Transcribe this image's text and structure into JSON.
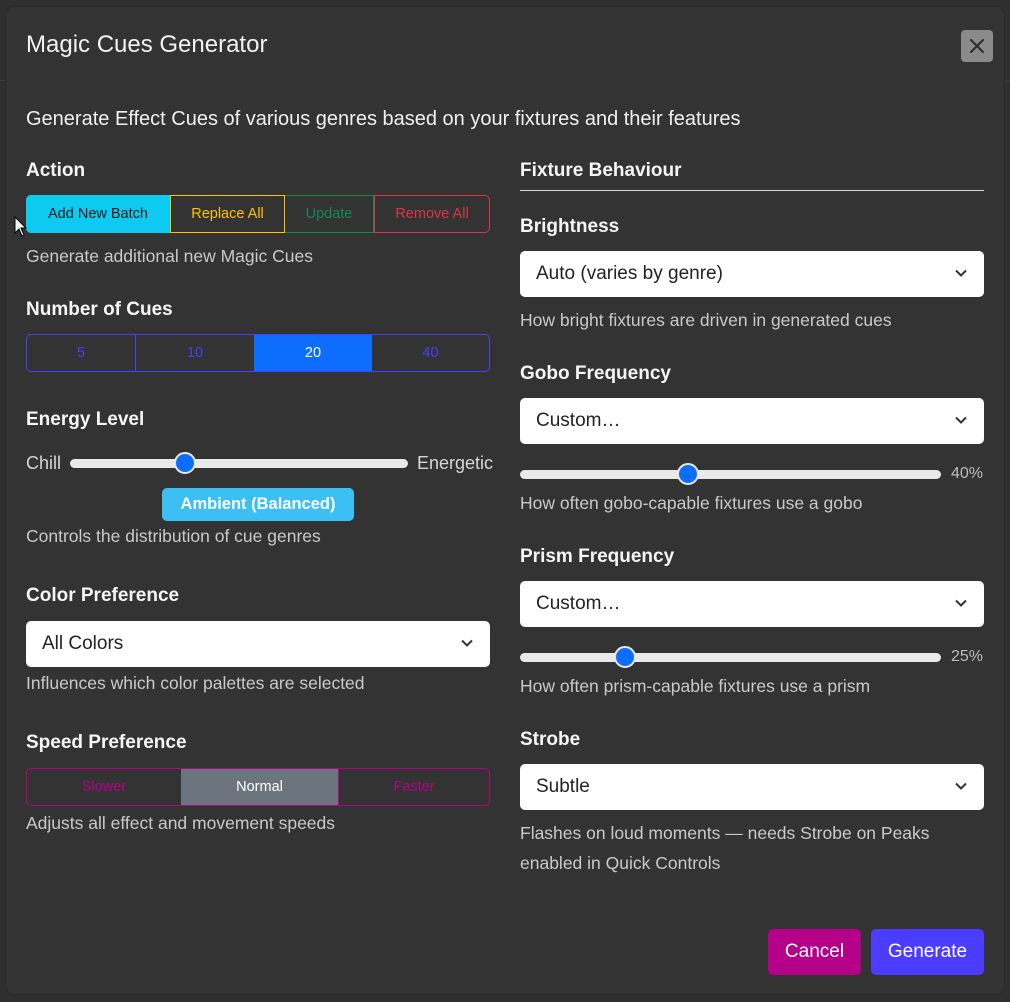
{
  "dialog": {
    "title": "Magic Cues Generator",
    "intro": "Generate Effect Cues of various genres based on your fixtures and their features"
  },
  "action": {
    "label": "Action",
    "buttons": [
      "Add New Batch",
      "Replace All",
      "Update",
      "Remove All"
    ],
    "selected": "Add New Batch",
    "help": "Generate additional new Magic Cues"
  },
  "num_cues": {
    "label": "Number of Cues",
    "options": [
      "5",
      "10",
      "20",
      "40"
    ],
    "selected": "20"
  },
  "energy": {
    "label": "Energy Level",
    "min_label": "Chill",
    "max_label": "Energetic",
    "value": 0.34,
    "badge": "Ambient (Balanced)",
    "help": "Controls the distribution of cue genres"
  },
  "color_pref": {
    "label": "Color Preference",
    "value": "All Colors",
    "help": "Influences which color palettes are selected"
  },
  "speed_pref": {
    "label": "Speed Preference",
    "options": [
      "Slower",
      "Normal",
      "Faster"
    ],
    "selected": "Normal",
    "help": "Adjusts all effect and movement speeds"
  },
  "fixture_behaviour": {
    "label": "Fixture Behaviour",
    "brightness": {
      "label": "Brightness",
      "value": "Auto (varies by genre)",
      "help": "How bright fixtures are driven in generated cues"
    },
    "gobo": {
      "label": "Gobo Frequency",
      "value": "Custom…",
      "percent": 40,
      "percent_text": "40%",
      "help": "How often gobo-capable fixtures use a gobo"
    },
    "prism": {
      "label": "Prism Frequency",
      "value": "Custom…",
      "percent": 25,
      "percent_text": "25%",
      "help": "How often prism-capable fixtures use a prism"
    },
    "strobe": {
      "label": "Strobe",
      "value": "Subtle",
      "help_line1": "Flashes on loud moments — needs Strobe on Peaks",
      "help_line2": "enabled in Quick Controls"
    }
  },
  "footer": {
    "cancel": "Cancel",
    "generate": "Generate"
  },
  "colors": {
    "primary": "#0d6efd",
    "info": "#0dcaf0",
    "warning": "#ffc107",
    "success": "#198754",
    "danger": "#dc3545",
    "indigo": "#4b3cff",
    "magenta": "#b5008a"
  }
}
